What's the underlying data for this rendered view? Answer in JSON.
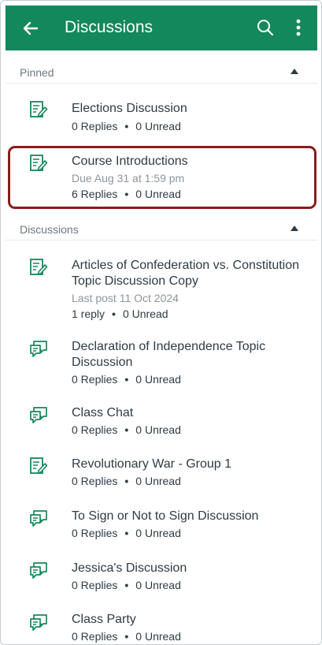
{
  "appbar": {
    "title": "Discussions",
    "back_icon": "arrow-left-icon",
    "search_icon": "search-icon",
    "more_icon": "more-vertical-icon",
    "color": "#13885c"
  },
  "pinned": {
    "header": "Pinned",
    "items": [
      {
        "title": "Elections Discussion",
        "replies": "0 Replies",
        "unread": "0 Unread",
        "icon": "assignment-discussion-icon"
      },
      {
        "title": "Course Introductions",
        "due": "Due Aug 31 at 1:59 pm",
        "replies": "6 Replies",
        "unread": "0 Unread",
        "icon": "assignment-discussion-icon",
        "selected": true
      }
    ]
  },
  "discussions": {
    "header": "Discussions",
    "items": [
      {
        "title": "Articles of Confederation vs. Constitution Topic Discussion Copy",
        "last_post": "Last post 11 Oct 2024",
        "replies": "1 reply",
        "unread": "0 Unread",
        "icon": "assignment-discussion-icon"
      },
      {
        "title": "Declaration of Independence Topic Discussion",
        "replies": "0 Replies",
        "unread": "0 Unread",
        "icon": "discussion-icon"
      },
      {
        "title": "Class Chat",
        "replies": "0 Replies",
        "unread": "0 Unread",
        "icon": "discussion-icon"
      },
      {
        "title": "Revolutionary War - Group 1",
        "replies": "0 Replies",
        "unread": "0 Unread",
        "icon": "assignment-discussion-icon"
      },
      {
        "title": "To Sign or Not to Sign Discussion",
        "replies": "0 Replies",
        "unread": "0 Unread",
        "icon": "discussion-icon"
      },
      {
        "title": "Jessica's Discussion",
        "replies": "0 Replies",
        "unread": "0 Unread",
        "icon": "discussion-icon"
      },
      {
        "title": "Class Party",
        "replies": "0 Replies",
        "unread": "0 Unread",
        "icon": "discussion-icon"
      }
    ]
  },
  "separator": "•",
  "colors": {
    "accent": "#13885c",
    "highlight": "#8a1c1c"
  }
}
